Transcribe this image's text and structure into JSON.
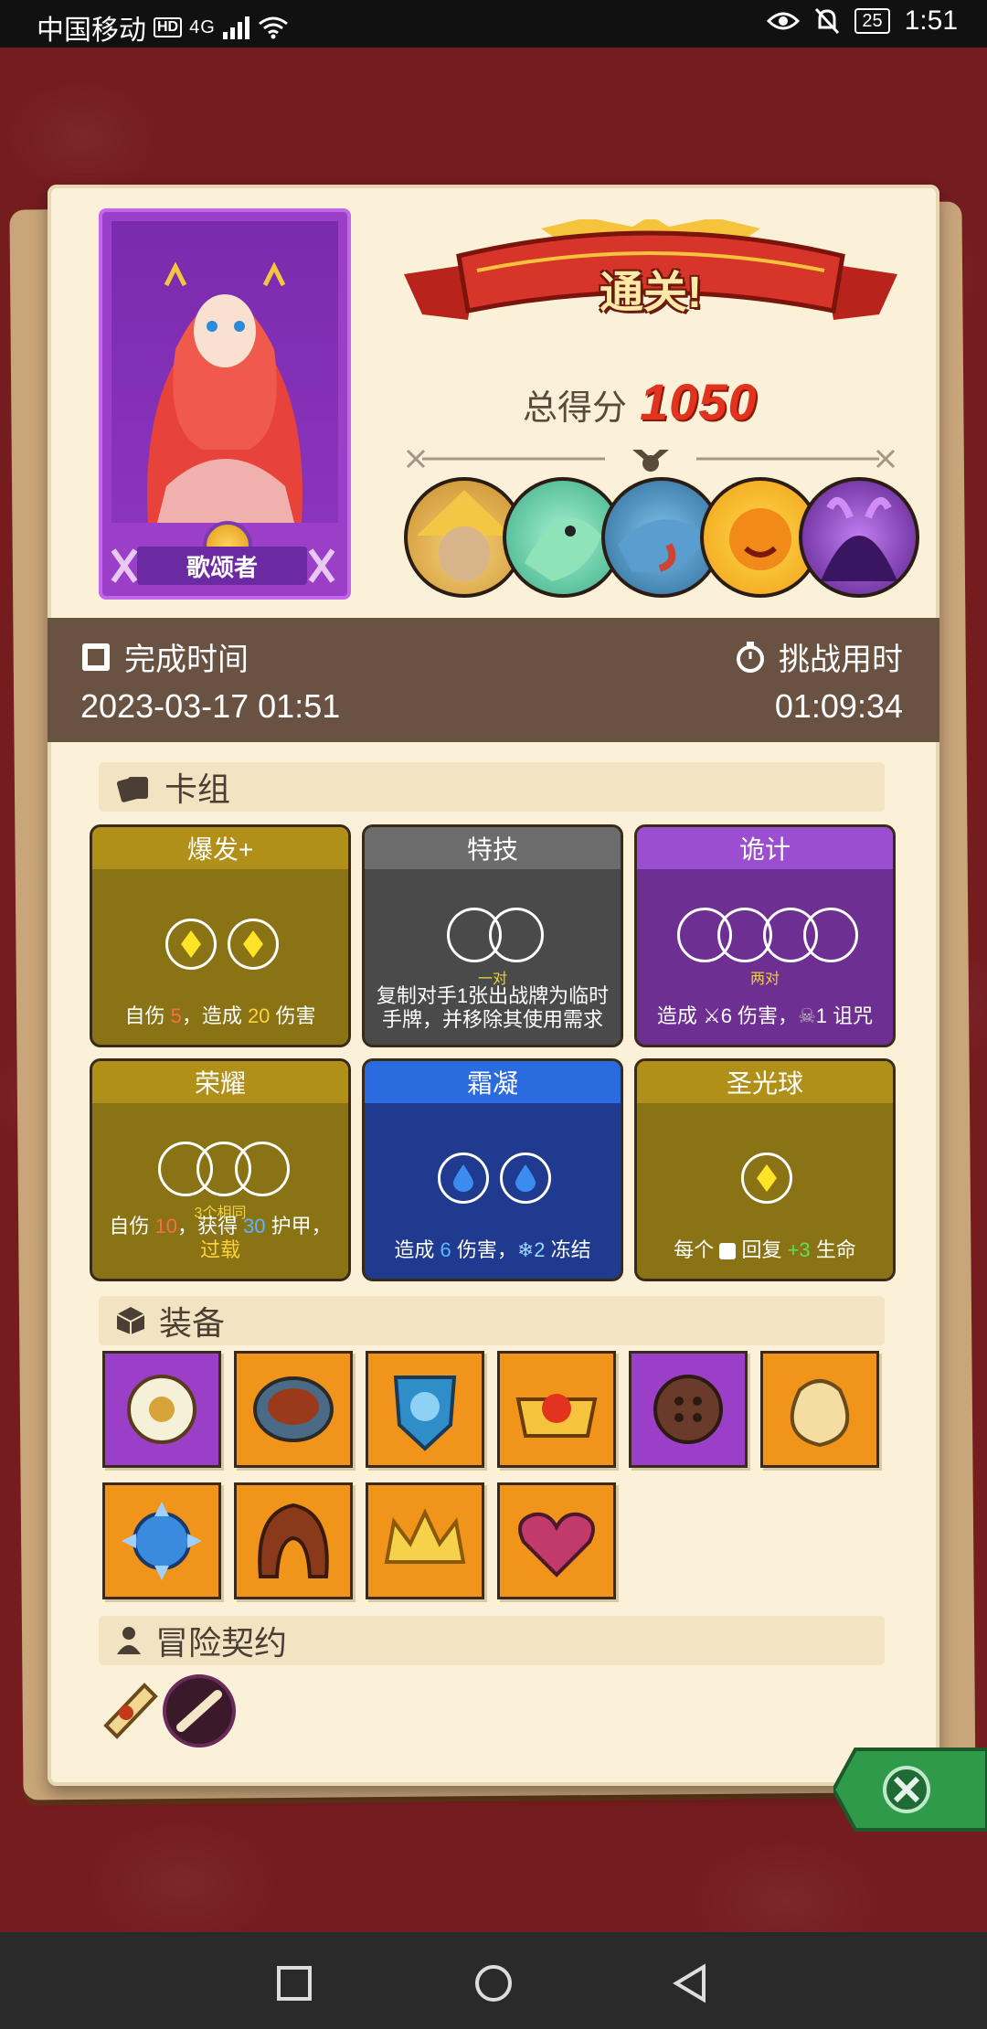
{
  "status_bar": {
    "carrier": "中国移动",
    "hd": "HD",
    "network": "4G",
    "battery": "25",
    "time": "1:51"
  },
  "hero": {
    "name": "歌颂者",
    "card_color": "#9b3ec8"
  },
  "result": {
    "banner": "通关!",
    "score_label": "总得分",
    "score_value": "1050"
  },
  "bosses": [
    "straw-hat-scarecrow-boss",
    "green-lizard-boss",
    "blue-shark-boss",
    "pumpkin-sun-boss",
    "purple-demon-boss"
  ],
  "time": {
    "finish_label": "完成时间",
    "finish_value": "2023-03-17 01:51",
    "challenge_label": "挑战用时",
    "challenge_value": "01:09:34"
  },
  "deck": {
    "title": "卡组",
    "cards": [
      {
        "name": "爆发+",
        "color": "#8a7314",
        "sub": "",
        "desc_parts": [
          "自伤 ",
          "5",
          "，造成 ",
          "20",
          " 伤害"
        ]
      },
      {
        "name": "特技",
        "color": "#5a5a5a",
        "sub": "一对",
        "desc": "复制对手1张出战牌为临时手牌，并移除其使用需求"
      },
      {
        "name": "诡计",
        "color": "#6e2f92",
        "sub": "两对",
        "desc_parts": [
          "造成 ",
          "6",
          " 伤害，",
          "1",
          " 诅咒"
        ]
      },
      {
        "name": "荣耀",
        "color": "#8a7314",
        "sub": "3个相同",
        "desc_parts": [
          "自伤 ",
          "10",
          "，获得 ",
          "30",
          " 护甲，",
          "过载"
        ]
      },
      {
        "name": "霜凝",
        "color": "#1f3a8f",
        "sub": "",
        "desc_parts": [
          "造成 ",
          "6",
          " 伤害，",
          "2",
          " 冻结"
        ]
      },
      {
        "name": "圣光球",
        "color": "#8a7314",
        "sub": "",
        "desc_parts": [
          "每个 ",
          " 回复 ",
          "+3",
          " 生命"
        ]
      }
    ]
  },
  "equipment": {
    "title": "装备",
    "items": [
      {
        "name": "eye-shield-relic",
        "bg": "#9b3ec8"
      },
      {
        "name": "bronze-ring-relic",
        "bg": "#f0941a"
      },
      {
        "name": "pumpkin-shield-relic",
        "bg": "#f0941a"
      },
      {
        "name": "golden-crown-relic",
        "bg": "#f0941a"
      },
      {
        "name": "button-relic",
        "bg": "#9b3ec8"
      },
      {
        "name": "coin-bag-relic",
        "bg": "#f0941a"
      },
      {
        "name": "spiked-blue-relic",
        "bg": "#f0941a"
      },
      {
        "name": "leather-hood-relic",
        "bg": "#f0941a"
      },
      {
        "name": "crown-relic",
        "bg": "#f0941a"
      },
      {
        "name": "cursed-heart-relic",
        "bg": "#f0941a"
      }
    ]
  },
  "contract": {
    "title": "冒险契约",
    "items": [
      "scroll-contract",
      "bone-contract"
    ]
  },
  "colors": {
    "accent_red": "#e2331f",
    "panel": "#fbf1d8",
    "time_band": "#6a5243",
    "close_green": "#2e9a4a"
  }
}
